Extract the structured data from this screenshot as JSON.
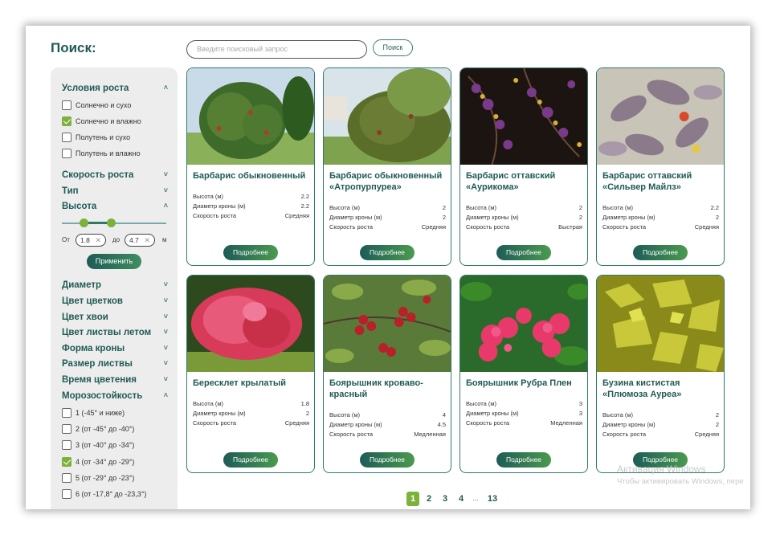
{
  "search": {
    "title": "Поиск:",
    "placeholder": "Введите поисковый запрос",
    "button": "Поиск"
  },
  "filters": {
    "growth_conditions": {
      "label": "Условия роста",
      "options": [
        {
          "label": "Солнечно и сухо",
          "checked": false
        },
        {
          "label": "Солнечно и влажно",
          "checked": true
        },
        {
          "label": "Полутень и сухо",
          "checked": false
        },
        {
          "label": "Полутень и влажно",
          "checked": false
        }
      ]
    },
    "growth_speed": "Скорость роста",
    "type": "Тип",
    "height": {
      "label": "Высота",
      "from_label": "От",
      "from_value": "1.8",
      "to_label": "до",
      "to_value": "4.7",
      "unit": "м",
      "apply": "Применить"
    },
    "collapsed_sections": [
      "Диаметр",
      "Цвет цветков",
      "Цвет хвои",
      "Цвет листвы летом",
      "Форма кроны",
      "Размер листвы",
      "Время цветения"
    ],
    "frost": {
      "label": "Морозостойкость",
      "options": [
        {
          "label": "1 (-45° и ниже)",
          "checked": false
        },
        {
          "label": "2 (от -45° до -40°)",
          "checked": false
        },
        {
          "label": "3 (от -40° до -34°)",
          "checked": false
        },
        {
          "label": "4 (от -34° до -29°)",
          "checked": true
        },
        {
          "label": "5 (от -29° до -23°)",
          "checked": false
        },
        {
          "label": "6 (от -17,8° до -23,3°)",
          "checked": false
        }
      ]
    }
  },
  "spec_labels": {
    "height": "Высота (м)",
    "diameter": "Диаметр кроны (м)",
    "speed": "Скорость роста"
  },
  "more_label": "Подробнее",
  "products": [
    {
      "title": "Барбарис обыкновенный",
      "height": "2.2",
      "diameter": "2.2",
      "speed": "Средняя",
      "image": "green-shrub"
    },
    {
      "title": "Барбарис обыкновенный «Атропурпуреа»",
      "height": "2",
      "diameter": "2",
      "speed": "Средняя",
      "image": "shrub-building"
    },
    {
      "title": "Барбарис оттавский «Аурикома»",
      "height": "2",
      "diameter": "2",
      "speed": "Быстрая",
      "image": "purple-berries"
    },
    {
      "title": "Барбарис оттавский «Сильвер Майлз»",
      "height": "2.2",
      "diameter": "2",
      "speed": "Средняя",
      "image": "silver-leaves"
    },
    {
      "title": "Бересклет крылатый",
      "height": "1.8",
      "diameter": "2",
      "speed": "Средняя",
      "image": "pink-shrub"
    },
    {
      "title": "Боярышник кроваво-красный",
      "height": "4",
      "diameter": "4.5",
      "speed": "Медленная",
      "image": "red-berries"
    },
    {
      "title": "Боярышник Рубра Плен",
      "height": "3",
      "diameter": "3",
      "speed": "Медленная",
      "image": "pink-flowers"
    },
    {
      "title": "Бузина кистистая «Плюмоза Ауреа»",
      "height": "2",
      "diameter": "2",
      "speed": "Средняя",
      "image": "yellow-leaves"
    }
  ],
  "pagination": {
    "pages": [
      "1",
      "2",
      "3",
      "4",
      "...",
      "13"
    ],
    "active": "1"
  },
  "watermark": {
    "line1": "Активация Windows",
    "line2": "Чтобы активировать Windows, пере"
  },
  "colors": {
    "brand": "#1f5a55",
    "accent": "#7cb13a"
  }
}
